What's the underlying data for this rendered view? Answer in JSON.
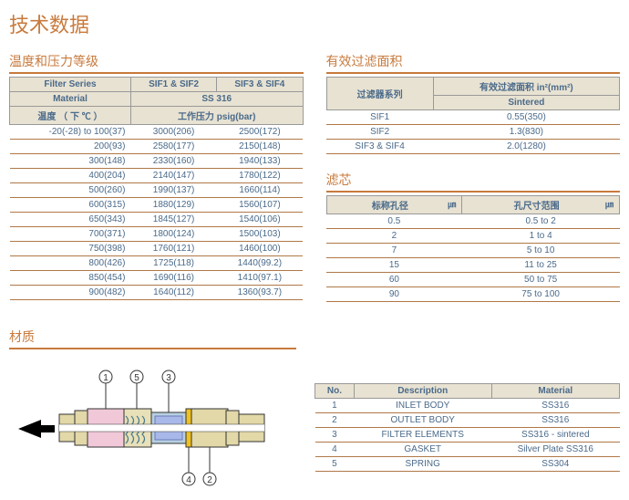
{
  "page_title": "技术数据",
  "temp_section": {
    "title": "温度和压力等级",
    "header": {
      "filter_series": "Filter Series",
      "sif12": "SIF1 & SIF2",
      "sif34": "SIF3 & SIF4",
      "material": "Material",
      "material_val": "SS 316",
      "temp_label": "温度   （ 下 ℃   ）",
      "press_label": "工作压力  psig(bar)"
    },
    "rows": [
      {
        "t": "-20(-28) to 100(37)",
        "a": "3000(206)",
        "b": "2500(172)"
      },
      {
        "t": "200(93)",
        "a": "2580(177)",
        "b": "2150(148)"
      },
      {
        "t": "300(148)",
        "a": "2330(160)",
        "b": "1940(133)"
      },
      {
        "t": "400(204)",
        "a": "2140(147)",
        "b": "1780(122)"
      },
      {
        "t": "500(260)",
        "a": "1990(137)",
        "b": "1660(114)"
      },
      {
        "t": "600(315)",
        "a": "1880(129)",
        "b": "1560(107)"
      },
      {
        "t": "650(343)",
        "a": "1845(127)",
        "b": "1540(106)"
      },
      {
        "t": "700(371)",
        "a": "1800(124)",
        "b": "1500(103)"
      },
      {
        "t": "750(398)",
        "a": "1760(121)",
        "b": "1460(100)"
      },
      {
        "t": "800(426)",
        "a": "1725(118)",
        "b": "1440(99.2)"
      },
      {
        "t": "850(454)",
        "a": "1690(116)",
        "b": "1410(97.1)"
      },
      {
        "t": "900(482)",
        "a": "1640(112)",
        "b": "1360(93.7)"
      }
    ]
  },
  "filt_section": {
    "title": "有效过滤面积",
    "h1": "过滤器系列",
    "h2": "有效过滤面积 in²(mm²)",
    "h3": "Sintered",
    "rows": [
      {
        "s": "SIF1",
        "v": "0.55(350)"
      },
      {
        "s": "SIF2",
        "v": "1.3(830)"
      },
      {
        "s": "SIF3 & SIF4",
        "v": "2.0(1280)"
      }
    ]
  },
  "cart_section": {
    "title": "滤芯",
    "h1": "标称孔径",
    "u1": "㎛",
    "h2": "孔尺寸范围",
    "u2": "㎛",
    "rows": [
      {
        "a": "0.5",
        "b": "0.5 to 2"
      },
      {
        "a": "2",
        "b": "1 to 4"
      },
      {
        "a": "7",
        "b": "5 to 10"
      },
      {
        "a": "15",
        "b": "11 to 25"
      },
      {
        "a": "60",
        "b": "50 to 75"
      },
      {
        "a": "90",
        "b": "75 to 100"
      }
    ]
  },
  "material_section": {
    "title": "材质",
    "h_no": "No.",
    "h_desc": "Description",
    "h_mat": "Material",
    "rows": [
      {
        "n": "1",
        "d": "INLET BODY",
        "m": "SS316"
      },
      {
        "n": "2",
        "d": "OUTLET BODY",
        "m": "SS316"
      },
      {
        "n": "3",
        "d": "FILTER ELEMENTS",
        "m": "SS316 - sintered"
      },
      {
        "n": "4",
        "d": "GASKET",
        "m": "Silver Plate SS316"
      },
      {
        "n": "5",
        "d": "SPRING",
        "m": "SS304"
      }
    ]
  }
}
